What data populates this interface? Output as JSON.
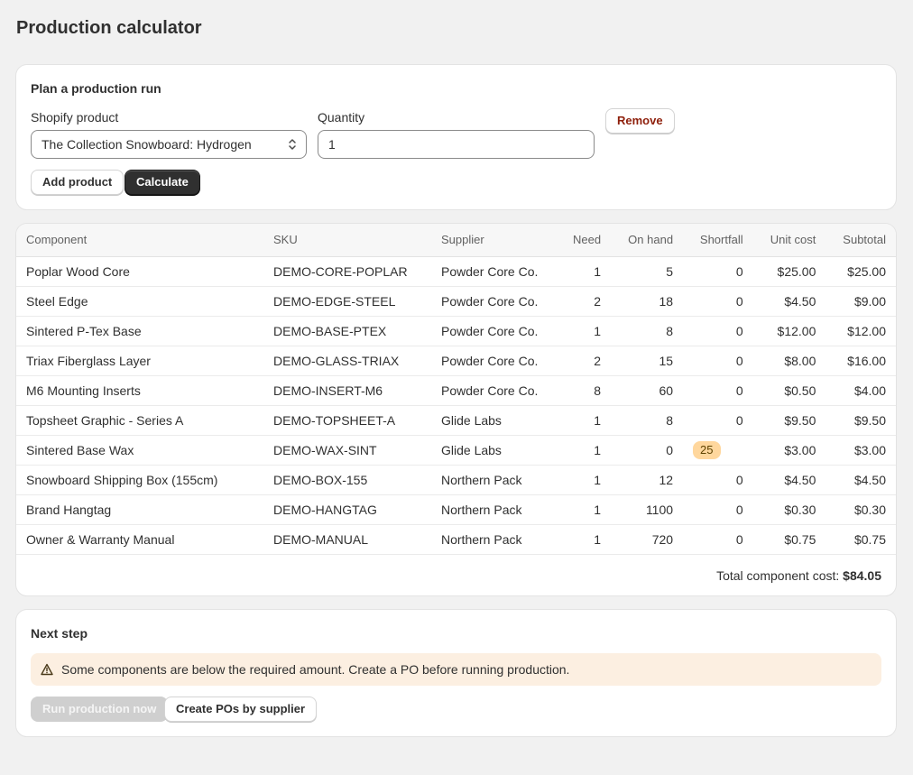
{
  "page": {
    "title": "Production calculator"
  },
  "plan": {
    "heading": "Plan a production run",
    "product_label": "Shopify product",
    "product_value": "The Collection Snowboard: Hydrogen",
    "quantity_label": "Quantity",
    "quantity_value": "1",
    "remove_label": "Remove",
    "add_product_label": "Add product",
    "calculate_label": "Calculate"
  },
  "table": {
    "headers": [
      "Component",
      "SKU",
      "Supplier",
      "Need",
      "On hand",
      "Shortfall",
      "Unit cost",
      "Subtotal"
    ],
    "rows": [
      [
        "Poplar Wood Core",
        "DEMO-CORE-POPLAR",
        "Powder Core Co.",
        "1",
        "5",
        "0",
        "$25.00",
        "$25.00"
      ],
      [
        "Steel Edge",
        "DEMO-EDGE-STEEL",
        "Powder Core Co.",
        "2",
        "18",
        "0",
        "$4.50",
        "$9.00"
      ],
      [
        "Sintered P-Tex Base",
        "DEMO-BASE-PTEX",
        "Powder Core Co.",
        "1",
        "8",
        "0",
        "$12.00",
        "$12.00"
      ],
      [
        "Triax Fiberglass Layer",
        "DEMO-GLASS-TRIAX",
        "Powder Core Co.",
        "2",
        "15",
        "0",
        "$8.00",
        "$16.00"
      ],
      [
        "M6 Mounting Inserts",
        "DEMO-INSERT-M6",
        "Powder Core Co.",
        "8",
        "60",
        "0",
        "$0.50",
        "$4.00"
      ],
      [
        "Topsheet Graphic - Series A",
        "DEMO-TOPSHEET-A",
        "Glide Labs",
        "1",
        "8",
        "0",
        "$9.50",
        "$9.50"
      ],
      [
        "Sintered Base Wax",
        "DEMO-WAX-SINT",
        "Glide Labs",
        "1",
        "0",
        "25",
        "$3.00",
        "$3.00"
      ],
      [
        "Snowboard Shipping Box (155cm)",
        "DEMO-BOX-155",
        "Northern Pack",
        "1",
        "12",
        "0",
        "$4.50",
        "$4.50"
      ],
      [
        "Brand Hangtag",
        "DEMO-HANGTAG",
        "Northern Pack",
        "1",
        "1100",
        "0",
        "$0.30",
        "$0.30"
      ],
      [
        "Owner & Warranty Manual",
        "DEMO-MANUAL",
        "Northern Pack",
        "1",
        "720",
        "0",
        "$0.75",
        "$0.75"
      ]
    ],
    "shortfall_badge_rows": [
      6
    ],
    "total_label": "Total component cost:",
    "total_value": "$84.05"
  },
  "next_step": {
    "heading": "Next step",
    "warning_icon": "alert-triangle-icon",
    "warning_text": "Some components are below the required amount. Create a PO before running production.",
    "run_label": "Run production now",
    "create_pos_label": "Create POs by supplier"
  },
  "colors": {
    "background": "#f1f1f1",
    "primary_button": "#303030",
    "warning_banner": "#fcefe1",
    "shortfall_badge": "#ffd79d",
    "remove_text": "#8e1f0b"
  }
}
